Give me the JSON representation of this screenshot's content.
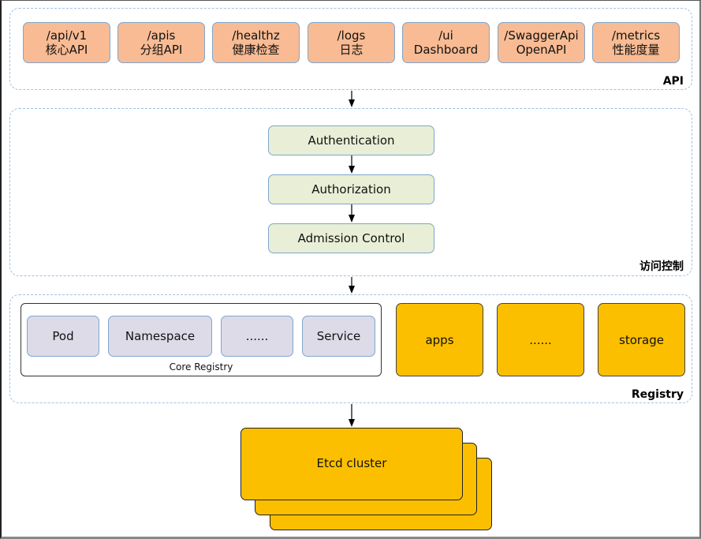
{
  "colors": {
    "api_fill": "#f8bb93",
    "auth_fill": "#e8efd6",
    "resource_fill": "#dddbe8",
    "registry_group_fill": "#fcbf00",
    "etcd_fill": "#fcbf00",
    "box_border": "#7ea6cf",
    "group_border": "#9cc3e6"
  },
  "api_layer": {
    "label": "API",
    "endpoints": [
      {
        "path": "/api/v1",
        "desc": "核心API"
      },
      {
        "path": "/apis",
        "desc": "分组API"
      },
      {
        "path": "/healthz",
        "desc": "健康检查"
      },
      {
        "path": "/logs",
        "desc": "日志"
      },
      {
        "path": "/ui",
        "desc": "Dashboard"
      },
      {
        "path": "/SwaggerApi",
        "desc": "OpenAPI"
      },
      {
        "path": "/metrics",
        "desc": "性能度量"
      }
    ]
  },
  "access_control": {
    "label": "访问控制",
    "steps": [
      "Authentication",
      "Authorization",
      "Admission Control"
    ]
  },
  "registry": {
    "label": "Registry",
    "core": {
      "label": "Core Registry",
      "resources": [
        "Pod",
        "Namespace",
        "......",
        "Service"
      ]
    },
    "groups": [
      "apps",
      "......",
      "storage"
    ]
  },
  "etcd": {
    "label": "Etcd cluster"
  }
}
